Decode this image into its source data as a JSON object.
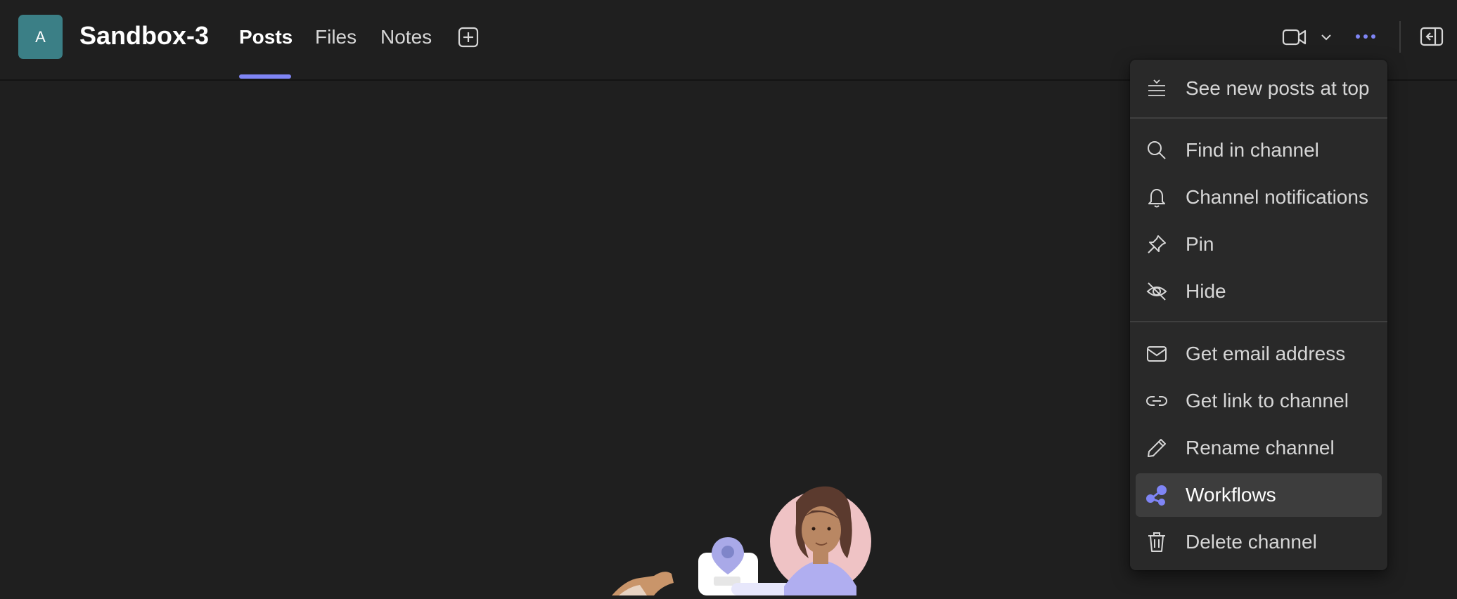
{
  "header": {
    "avatar_letter": "A",
    "title": "Sandbox-3",
    "tabs": [
      {
        "label": "Posts",
        "active": true
      },
      {
        "label": "Files",
        "active": false
      },
      {
        "label": "Notes",
        "active": false
      }
    ]
  },
  "icons": {
    "add_tab": "plus-square-icon",
    "video": "video-camera-icon",
    "chevron": "chevron-down-icon",
    "more": "more-horizontal-icon",
    "panel": "open-pane-icon"
  },
  "menu": {
    "items": [
      {
        "label": "See new posts at top",
        "icon": "new-posts-top-icon"
      },
      {
        "label": "Find in channel",
        "icon": "search-icon"
      },
      {
        "label": "Channel notifications",
        "icon": "bell-icon"
      },
      {
        "label": "Pin",
        "icon": "pin-icon"
      },
      {
        "label": "Hide",
        "icon": "eye-off-icon"
      },
      {
        "label": "Get email address",
        "icon": "mail-icon"
      },
      {
        "label": "Get link to channel",
        "icon": "link-icon"
      },
      {
        "label": "Rename channel",
        "icon": "pencil-icon"
      },
      {
        "label": "Workflows",
        "icon": "workflows-icon"
      },
      {
        "label": "Delete channel",
        "icon": "trash-icon"
      }
    ],
    "highlighted": "Workflows"
  },
  "colors": {
    "background": "#1f1f1f",
    "accent": "#7f85f5",
    "avatar": "#3b7f86",
    "menu": "#292929",
    "menu_hover": "#3d3d3d"
  }
}
